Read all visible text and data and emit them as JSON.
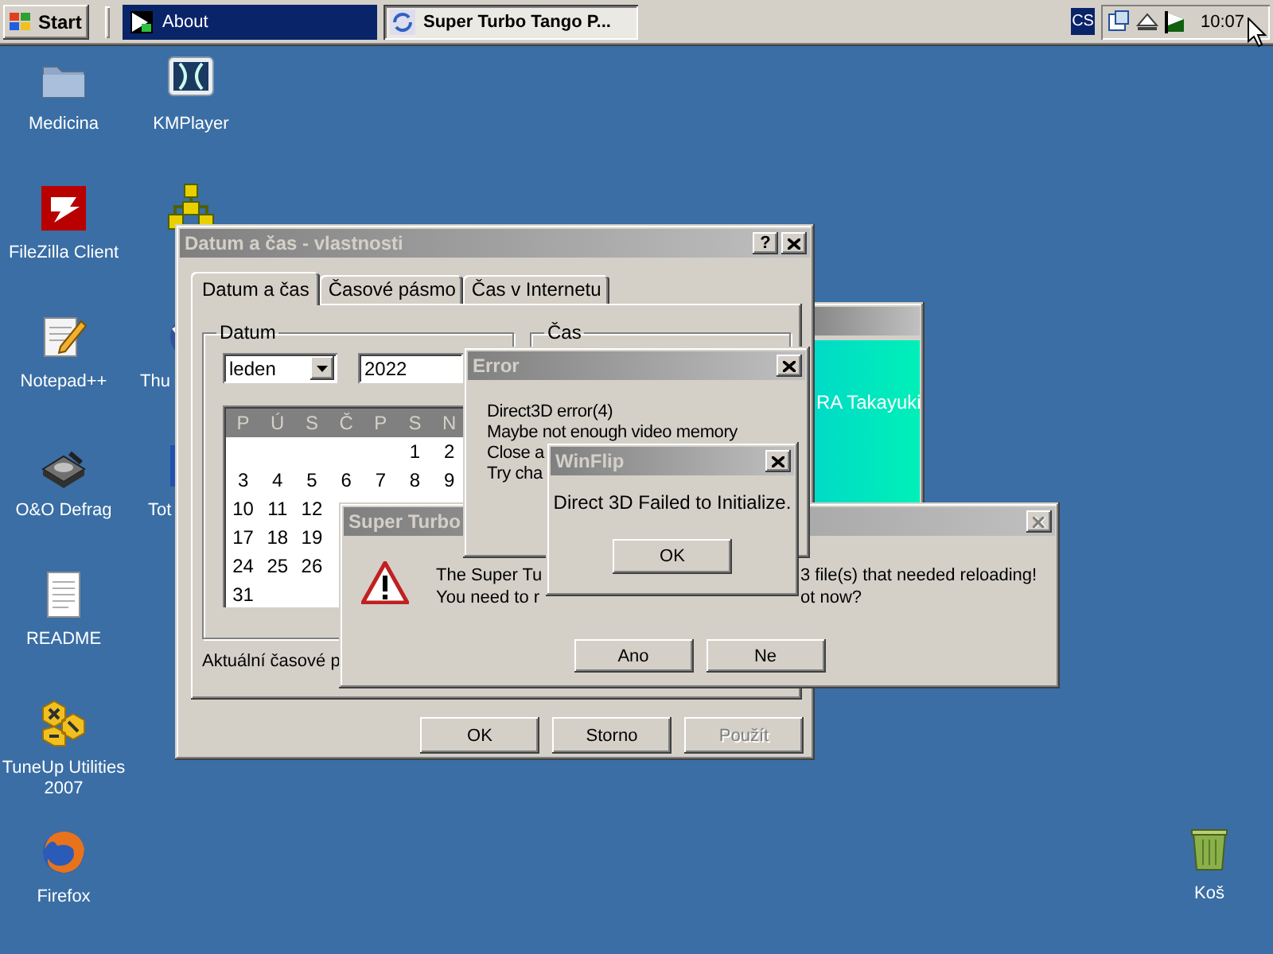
{
  "taskbar": {
    "start": "Start",
    "tasks": [
      {
        "label": "About",
        "flashing": true,
        "selected": false
      },
      {
        "label": "Super Turbo Tango P...",
        "flashing": false,
        "selected": true
      }
    ],
    "language": "CS",
    "clock": "10:07"
  },
  "desktop_icons": [
    {
      "kind": "folder",
      "label": "Medicina"
    },
    {
      "kind": "media",
      "label": "KMPlayer"
    },
    {
      "kind": "tile",
      "label": "FileZilla Client"
    },
    {
      "kind": "network"
    },
    {
      "kind": "notepad",
      "label": "Notepad++"
    },
    {
      "kind": "globe",
      "label": "Thu"
    },
    {
      "kind": "defrag",
      "label": "O&O Defrag"
    },
    {
      "kind": "commander",
      "label": "Tot"
    },
    {
      "kind": "document",
      "label": "README"
    },
    {
      "kind": "tuneup",
      "label": "TuneUp Utilities 2007"
    },
    {
      "kind": "browser",
      "label": "Firefox"
    },
    {
      "kind": "trash",
      "label": "Koš"
    }
  ],
  "windows": [
    {
      "kind": "banner_app",
      "active": false,
      "text": "RA Takayuki"
    },
    {
      "kind": "date_time",
      "title": "Datum a čas - vlastnosti",
      "active": false,
      "close_disabled": false,
      "help": "?",
      "tabs": [
        {
          "label": "Datum a čas",
          "selected": true
        },
        {
          "label": "Časové pásmo",
          "selected": false
        },
        {
          "label": "Čas v Internetu",
          "selected": false
        }
      ],
      "date_group": "Datum",
      "month": "leden",
      "year": "2022",
      "weekdays": [
        "P",
        "Ú",
        "S",
        "Č",
        "P",
        "S",
        "N"
      ],
      "weeks": [
        [
          "1",
          "2"
        ],
        [
          "3",
          "4",
          "5",
          "6",
          "7",
          "8",
          "9"
        ],
        [
          "10",
          "11",
          "12"
        ],
        [
          "17",
          "18",
          "19"
        ],
        [
          "24",
          "25",
          "26"
        ],
        [
          "31"
        ]
      ],
      "time_group": "Čas",
      "timezone_text": "Aktuální časové p",
      "buttons": [
        {
          "label": "OK",
          "disabled": false
        },
        {
          "label": "Storno",
          "disabled": false
        },
        {
          "label": "Použít",
          "disabled": true
        }
      ]
    },
    {
      "kind": "question",
      "title": "Super Turbo",
      "active": false,
      "close_disabled": true,
      "lines": [
        {
          "start": "The Super Tu",
          "end": "3 file(s) that needed reloading!"
        },
        {
          "start": "You need to r",
          "end": "ot now?"
        }
      ],
      "buttons": [
        {
          "label": "Ano",
          "disabled": false
        },
        {
          "label": "Ne",
          "disabled": false
        }
      ]
    },
    {
      "kind": "message_list",
      "title": "Error",
      "active": false,
      "close_disabled": false,
      "lines": [
        "Direct3D error(4)",
        "Maybe not enough video memory",
        "Close a",
        "Try cha"
      ]
    },
    {
      "kind": "message_box",
      "title": "WinFlip",
      "active": false,
      "close_disabled": false,
      "lines": [
        "Direct 3D Failed to Initialize."
      ],
      "buttons": [
        {
          "label": "OK",
          "disabled": false
        }
      ]
    }
  ]
}
